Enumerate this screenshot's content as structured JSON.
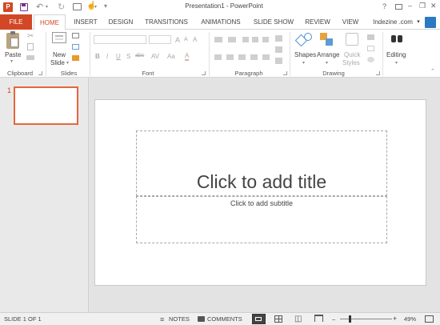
{
  "window": {
    "title": "Presentation1 - PowerPoint",
    "help": "?",
    "minimize": "–",
    "restore": "❐",
    "close": "✕"
  },
  "tabs": [
    "FILE",
    "HOME",
    "INSERT",
    "DESIGN",
    "TRANSITIONS",
    "ANIMATIONS",
    "SLIDE SHOW",
    "REVIEW",
    "VIEW"
  ],
  "account": {
    "name": "Indezine .com",
    "chevron": "▾"
  },
  "ribbon": {
    "clipboard": {
      "paste": "Paste",
      "label": "Clipboard"
    },
    "slides": {
      "new_slide_line1": "New",
      "new_slide_line2": "Slide",
      "label": "Slides"
    },
    "font": {
      "label": "Font",
      "bold": "B",
      "italic": "I",
      "underline": "U",
      "shadow": "S",
      "strike": "abc",
      "spacing": "AV",
      "case": "Aa",
      "color": "A",
      "grow": "A",
      "shrink": "A",
      "clear": "A"
    },
    "paragraph": {
      "label": "Paragraph"
    },
    "drawing": {
      "shapes": "Shapes",
      "arrange": "Arrange",
      "quick_styles_line1": "Quick",
      "quick_styles_line2": "Styles",
      "label": "Drawing"
    },
    "editing": {
      "label": "Editing"
    }
  },
  "thumbnail": {
    "number": "1"
  },
  "slide": {
    "title_placeholder": "Click to add title",
    "subtitle_placeholder": "Click to add subtitle"
  },
  "status": {
    "slide_info": "SLIDE 1 OF 1",
    "notes": "NOTES",
    "comments": "COMMENTS",
    "zoom_minus": "–",
    "zoom_plus": "+",
    "zoom": "49%"
  },
  "colors": {
    "accent": "#D24726",
    "file_tab": "#D24726",
    "text": "#444444",
    "workspace": "#E3E3E3"
  },
  "icons": [
    "powerpoint-logo-icon",
    "save-icon",
    "undo-icon",
    "redo-icon",
    "start-show-icon",
    "customize-qat-icon",
    "cut-icon",
    "copy-icon",
    "format-painter-icon",
    "find-icon",
    "notes-icon",
    "comments-icon",
    "normal-view-icon",
    "slide-sorter-icon",
    "reading-view-icon",
    "slideshow-view-icon",
    "fit-window-icon"
  ]
}
